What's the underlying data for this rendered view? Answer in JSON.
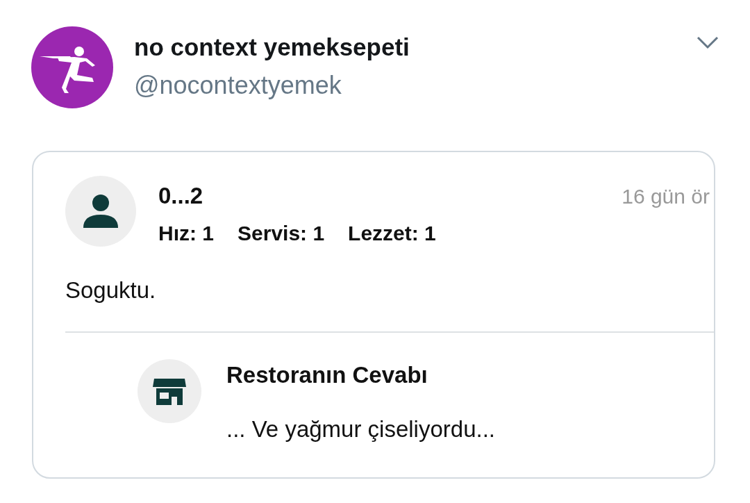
{
  "account": {
    "name": "no context yemeksepeti",
    "handle": "@nocontextyemek"
  },
  "review": {
    "reviewer": "0...2",
    "time": "16 gün ör",
    "ratings": [
      "Hız: 1",
      "Servis: 1",
      "Lezzet: 1"
    ],
    "comment": "Soguktu.",
    "reply": {
      "title": "Restoranın Cevabı",
      "text": "... Ve yağmur çiseliyordu..."
    }
  }
}
